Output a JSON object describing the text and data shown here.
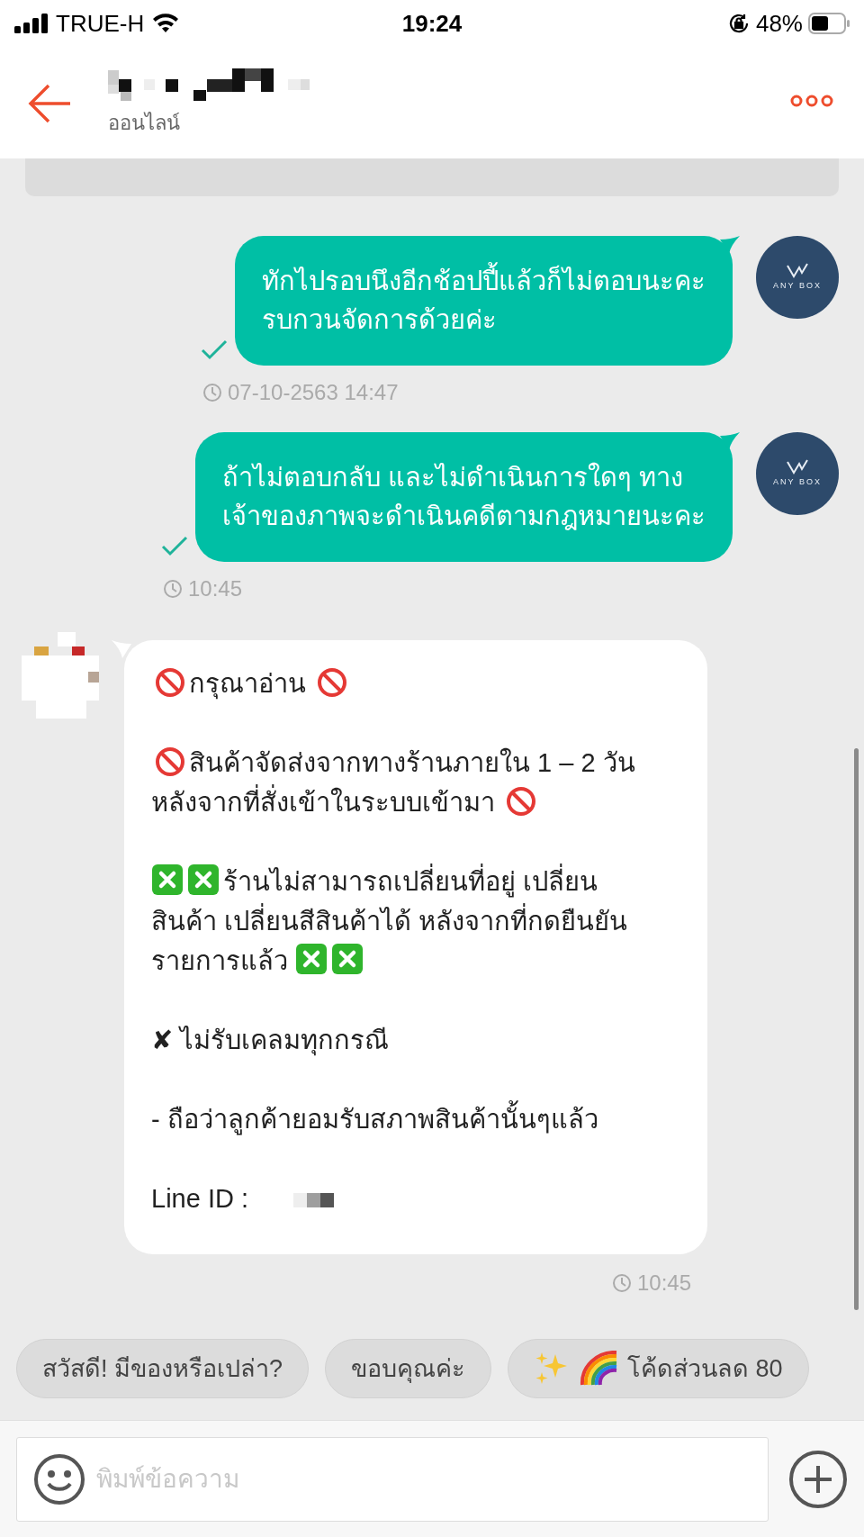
{
  "status_bar": {
    "carrier": "TRUE-H",
    "time": "19:24",
    "battery": "48%"
  },
  "header": {
    "subtitle": "ออนไลน์"
  },
  "messages": [
    {
      "kind": "outgoing",
      "paragraphs": [
        [
          [
            {
              "kind": "text",
              "text": "ทักไปรอบนึงอีกช้อปปี้แล้วก็ไม่ตอบนะคะ"
            }
          ],
          [
            {
              "kind": "text",
              "text": "รบกวนจัดการด้วยค่ะ"
            }
          ]
        ]
      ],
      "time": "07-10-2563 14:47",
      "delivered": true,
      "avatar": "ANY BOX"
    },
    {
      "kind": "outgoing",
      "paragraphs": [
        [
          [
            {
              "kind": "text",
              "text": "ถ้าไม่ตอบกลับ และไม่ดำเนินการใดๆ ทาง"
            }
          ],
          [
            {
              "kind": "text",
              "text": "เจ้าของภาพจะดำเนินคดีตามกฎหมายนะคะ"
            }
          ]
        ]
      ],
      "time": "10:45",
      "delivered": true,
      "avatar": "ANY BOX"
    },
    {
      "kind": "incoming",
      "paragraphs": [
        [
          [
            {
              "kind": "prohibited"
            },
            {
              "kind": "text",
              "text": "กรุณาอ่าน"
            },
            {
              "kind": "prohibited"
            }
          ]
        ],
        [
          [
            {
              "kind": "prohibited"
            },
            {
              "kind": "text",
              "text": "สินค้าจัดส่งจากทางร้านภายใน 1 – 2 วัน"
            }
          ],
          [
            {
              "kind": "text",
              "text": "หลังจากที่สั่งเข้าในระบบเข้ามา"
            },
            {
              "kind": "prohibited"
            }
          ]
        ],
        [
          [
            {
              "kind": "cross"
            },
            {
              "kind": "cross"
            },
            {
              "kind": "text",
              "text": "ร้านไม่สามารถเปลี่ยนที่อยู่ เปลี่ยน"
            }
          ],
          [
            {
              "kind": "text",
              "text": "สินค้า เปลี่ยนสีสินค้าได้ หลังจากที่กดยืนยัน"
            }
          ],
          [
            {
              "kind": "text",
              "text": "รายการแล้ว"
            },
            {
              "kind": "cross"
            },
            {
              "kind": "cross"
            }
          ]
        ],
        [
          [
            {
              "kind": "text",
              "text": "✘ ไม่รับเคลมทุกกรณี"
            }
          ]
        ],
        [
          [
            {
              "kind": "text",
              "text": "- ถือว่าลูกค้ายอมรับสภาพสินค้านั้นๆแล้ว"
            }
          ]
        ],
        [
          [
            {
              "kind": "text",
              "text": "Line ID :"
            },
            {
              "kind": "redacted"
            }
          ]
        ]
      ],
      "time": "10:45"
    }
  ],
  "quick_replies": [
    {
      "kind": "plain",
      "text": "สวัสดี! มีของหรือเปล่า?"
    },
    {
      "kind": "plain",
      "text": "ขอบคุณค่ะ"
    },
    {
      "kind": "promo",
      "text": "โค้ดส่วนลด 80"
    }
  ],
  "composer": {
    "placeholder": "พิมพ์ข้อความ"
  }
}
